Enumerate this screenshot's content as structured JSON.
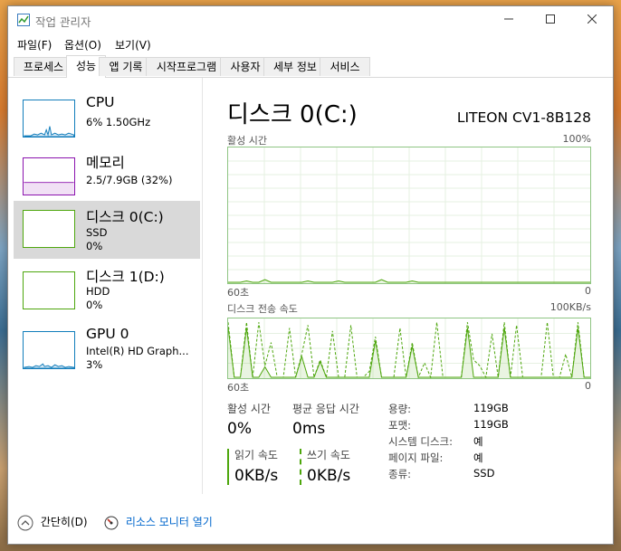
{
  "window": {
    "title": "작업 관리자"
  },
  "menu": [
    "파일(F)",
    "옵션(O)",
    "보기(V)"
  ],
  "tabs": [
    "프로세스",
    "성능",
    "앱 기록",
    "시작프로그램",
    "사용자",
    "세부 정보",
    "서비스"
  ],
  "sidebar": [
    {
      "title": "CPU",
      "line1": "6% 1.50GHz",
      "line2": ""
    },
    {
      "title": "메모리",
      "line1": "2.5/7.9GB (32%)",
      "line2": ""
    },
    {
      "title": "디스크 0(C:)",
      "line1": "SSD",
      "line2": "0%"
    },
    {
      "title": "디스크 1(D:)",
      "line1": "HDD",
      "line2": "0%"
    },
    {
      "title": "GPU 0",
      "line1": "Intel(R) HD Graph...",
      "line2": "3%"
    }
  ],
  "main": {
    "title": "디스크 0(C:)",
    "model": "LITEON CV1-8B128",
    "graph1": {
      "label": "활성 시간",
      "max": "100%",
      "time": "60초",
      "min": "0"
    },
    "graph2": {
      "label": "디스크 전송 속도",
      "max": "100KB/s",
      "time": "60초",
      "min": "0"
    },
    "stats": {
      "active_label": "활성 시간",
      "active_value": "0%",
      "response_label": "평균 응답 시간",
      "response_value": "0ms",
      "read_label": "읽기 속도",
      "read_value": "0KB/s",
      "write_label": "쓰기 속도",
      "write_value": "0KB/s"
    },
    "info": [
      {
        "key": "용량:",
        "value": "119GB"
      },
      {
        "key": "포맷:",
        "value": "119GB"
      },
      {
        "key": "시스템 디스크:",
        "value": "예"
      },
      {
        "key": "페이지 파일:",
        "value": "예"
      },
      {
        "key": "종류:",
        "value": "SSD"
      }
    ]
  },
  "footer": {
    "fewer_details": "간단히(D)",
    "resource_monitor": "리소스 모니터 열기"
  },
  "colors": {
    "disk": "#4da60c",
    "cpu": "#117dbb",
    "memory": "#8b12ae",
    "accent": "#0066cc"
  },
  "chart_data": {
    "type": "line",
    "series": [
      {
        "values": [
          0,
          0,
          0,
          1,
          0,
          0,
          2,
          0,
          0,
          0,
          0,
          0,
          0,
          1,
          0,
          0,
          0,
          0,
          1,
          0,
          0,
          0,
          0,
          0,
          0,
          2,
          0,
          0,
          0,
          0,
          1,
          0,
          0,
          0,
          0,
          0,
          0,
          0,
          0,
          0,
          0,
          0,
          0,
          0,
          0,
          0,
          0,
          0,
          0,
          0,
          0,
          0,
          0,
          0,
          0,
          0,
          0,
          0,
          0,
          0
        ]
      },
      {
        "values": [
          95,
          0,
          0,
          95,
          0,
          95,
          20,
          60,
          0,
          0,
          85,
          0,
          40,
          90,
          0,
          30,
          0,
          80,
          0,
          0,
          90,
          0,
          0,
          10,
          70,
          0,
          0,
          0,
          85,
          0,
          60,
          0,
          25,
          0,
          95,
          0,
          0,
          0,
          0,
          95,
          30,
          20,
          0,
          75,
          0,
          95,
          0,
          90,
          0,
          0,
          0,
          0,
          95,
          0,
          0,
          40,
          0,
          95,
          0,
          0
        ]
      }
    ],
    "ylim": [
      0,
      100
    ],
    "xlabel": "60초"
  }
}
